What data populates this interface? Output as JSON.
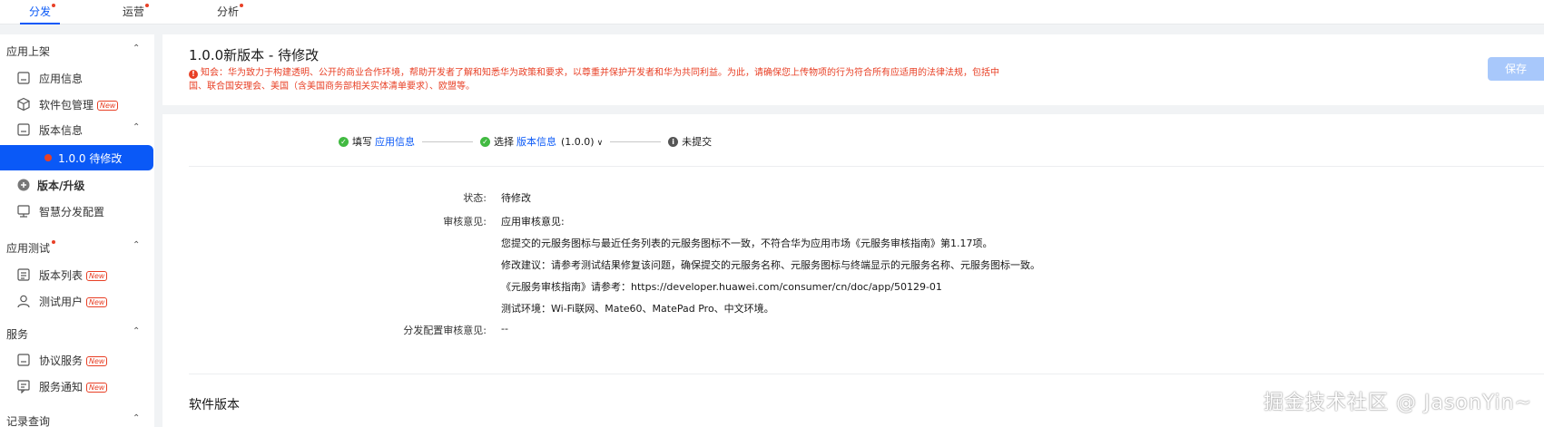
{
  "top_tabs": [
    {
      "label": "分发",
      "active": true
    },
    {
      "label": "运营",
      "active": false
    },
    {
      "label": "分析",
      "active": false
    }
  ],
  "sidebar": {
    "groups": [
      {
        "label": "应用上架"
      },
      {
        "label": "应用测试"
      },
      {
        "label": "服务"
      },
      {
        "label": "记录查询"
      }
    ],
    "items": [
      {
        "label": "应用信息",
        "icon": "app-info-icon"
      },
      {
        "label": "软件包管理",
        "icon": "package-icon",
        "tag": "New"
      },
      {
        "label": "版本信息",
        "icon": "version-info-icon"
      },
      {
        "label": "1.0.0 待修改",
        "active": true
      },
      {
        "label": "版本/升级",
        "icon": "add-circle-icon"
      },
      {
        "label": "智慧分发配置",
        "icon": "smart-distribution-icon"
      },
      {
        "label": "版本列表",
        "icon": "version-list-icon",
        "tag": "New"
      },
      {
        "label": "测试用户",
        "icon": "test-user-icon",
        "tag": "New"
      },
      {
        "label": "协议服务",
        "icon": "agreement-icon",
        "tag": "New"
      },
      {
        "label": "服务通知",
        "icon": "notification-icon",
        "tag": "New"
      }
    ]
  },
  "header": {
    "title": "1.0.0新版本 - 待修改",
    "notice": "知会：华为致力于构建透明、公开的商业合作环境，帮助开发者了解和知悉华为政策和要求，以尊重并保护开发者和华为共同利益。为此，请确保您上传物项的行为符合所有应适用的法律法规，包括中国、联合国安理会、美国（含美国商务部相关实体清单要求）、欧盟等。",
    "save_label": "保存"
  },
  "steps": {
    "step1_prefix": "填写",
    "step1_link": "应用信息",
    "step2_prefix": "选择",
    "step2_link": "版本信息",
    "step2_version": "(1.0.0)",
    "step3_label": "未提交"
  },
  "details": {
    "status_label": "状态:",
    "status_value": "待修改",
    "review_label": "审核意见:",
    "review_lines": [
      "应用审核意见:",
      "您提交的元服务图标与最近任务列表的元服务图标不一致，不符合华为应用市场《元服务审核指南》第1.17项。",
      "修改建议：请参考测试结果修复该问题，确保提交的元服务名称、元服务图标与终端显示的元服务名称、元服务图标一致。",
      "《元服务审核指南》请参考：https://developer.huawei.com/consumer/cn/doc/app/50129-01",
      "测试环境：Wi-Fi联网、Mate60、MatePad Pro、中文环境。"
    ],
    "dist_review_label": "分发配置审核意见:",
    "dist_review_value": "--"
  },
  "section": {
    "software_version_title": "软件版本"
  },
  "watermark": "掘金技术社区 @ JasonYin~",
  "colors": {
    "accent": "#0a59f7",
    "danger": "#e84026",
    "success": "#41ba41",
    "save_disabled": "#a8c8fb"
  }
}
